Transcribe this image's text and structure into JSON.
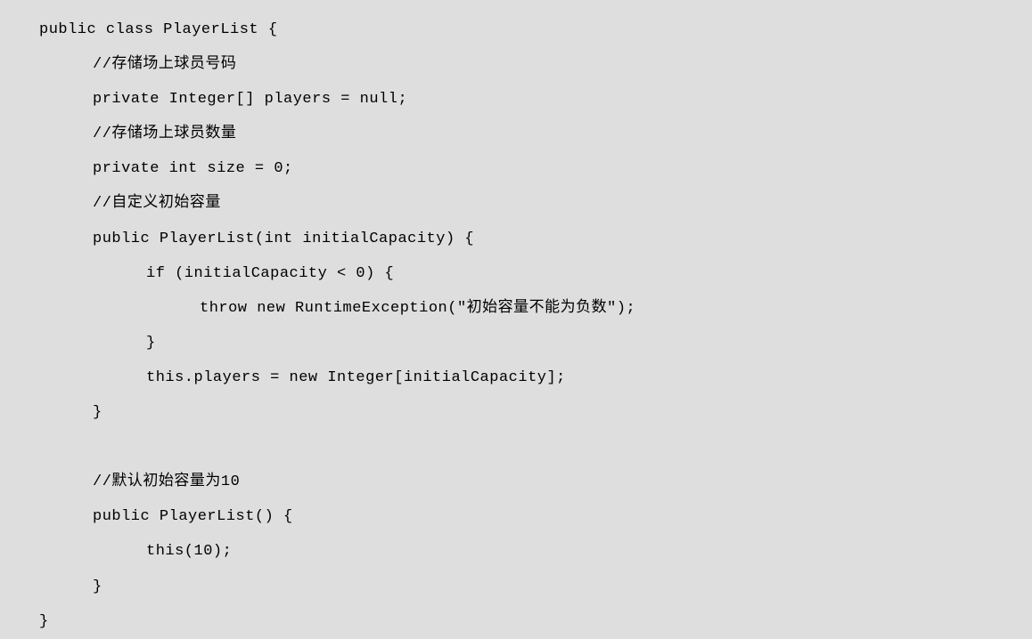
{
  "code": {
    "line1": "public class PlayerList {",
    "line2": "//存储场上球员号码",
    "line3": "private Integer[] players = null;",
    "line4": "//存储场上球员数量",
    "line5": "private int size = 0;",
    "line6": "//自定义初始容量",
    "line7": "public PlayerList(int initialCapacity) {",
    "line8": "if (initialCapacity < 0) {",
    "line9": "throw new RuntimeException(\"初始容量不能为负数\");",
    "line10": "}",
    "line11": "this.players = new Integer[initialCapacity];",
    "line12": "}",
    "line13": "//默认初始容量为10",
    "line14": "public PlayerList() {",
    "line15": "this(10);",
    "line16": "}",
    "line17": "}"
  }
}
